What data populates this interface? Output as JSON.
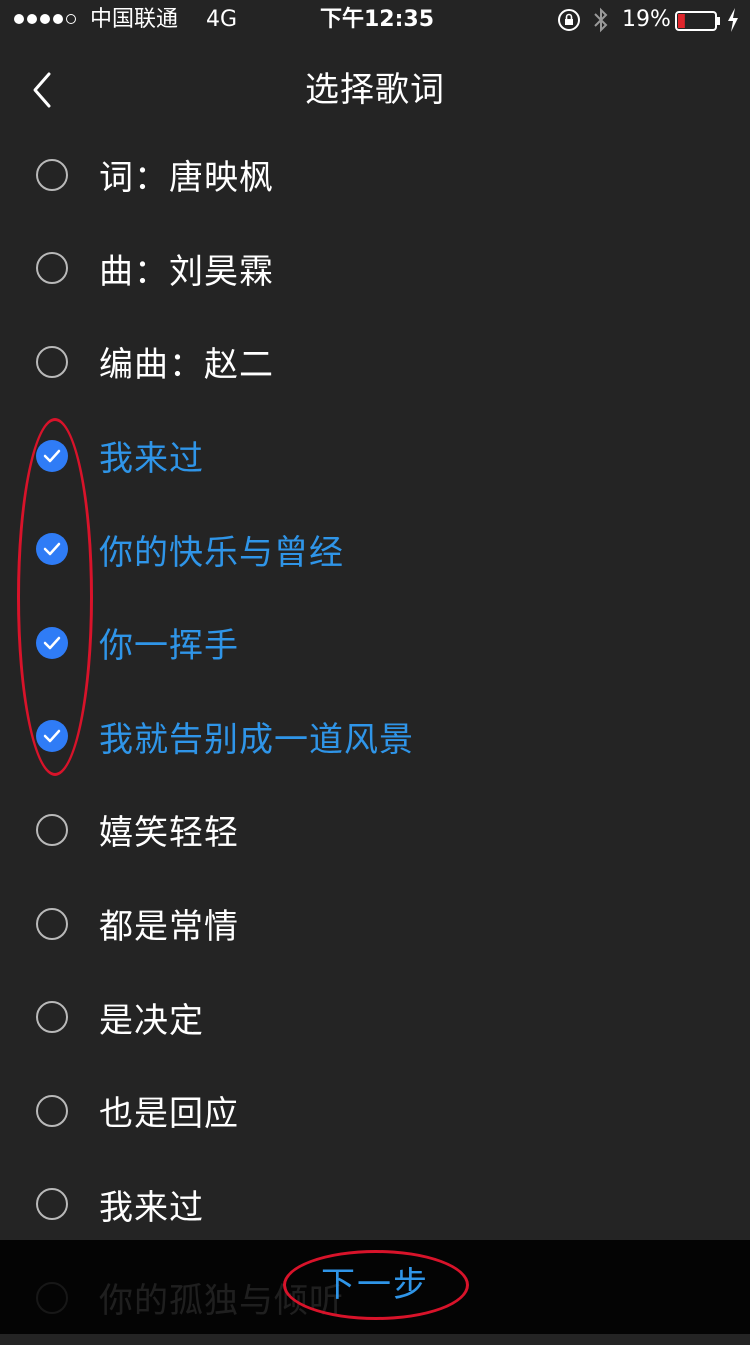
{
  "status_bar": {
    "carrier": "中国联通",
    "network": "4G",
    "time": "下午12:35",
    "battery_percent": "19%",
    "battery_level": 0.19,
    "colors": {
      "battery_low": "#e0262c"
    }
  },
  "header": {
    "title": "选择歌词",
    "back_icon": "chevron-left-icon"
  },
  "lyrics": [
    {
      "text": "词：唐映枫",
      "checked": false
    },
    {
      "text": "曲：刘昊霖",
      "checked": false
    },
    {
      "text": "编曲：赵二",
      "checked": false
    },
    {
      "text": "我来过",
      "checked": true
    },
    {
      "text": "你的快乐与曾经",
      "checked": true
    },
    {
      "text": "你一挥手",
      "checked": true
    },
    {
      "text": "我就告别成一道风景",
      "checked": true
    },
    {
      "text": "嬉笑轻轻",
      "checked": false
    },
    {
      "text": "都是常情",
      "checked": false
    },
    {
      "text": "是决定",
      "checked": false
    },
    {
      "text": "也是回应",
      "checked": false
    },
    {
      "text": "我来过",
      "checked": false
    },
    {
      "text": "你的孤独与倾听",
      "checked": false
    }
  ],
  "footer": {
    "next_label": "下一步"
  },
  "colors": {
    "background": "#242424",
    "accent": "#2f95e8",
    "checkbox_selected": "#2f7cf6",
    "annotation": "#d8132a"
  }
}
